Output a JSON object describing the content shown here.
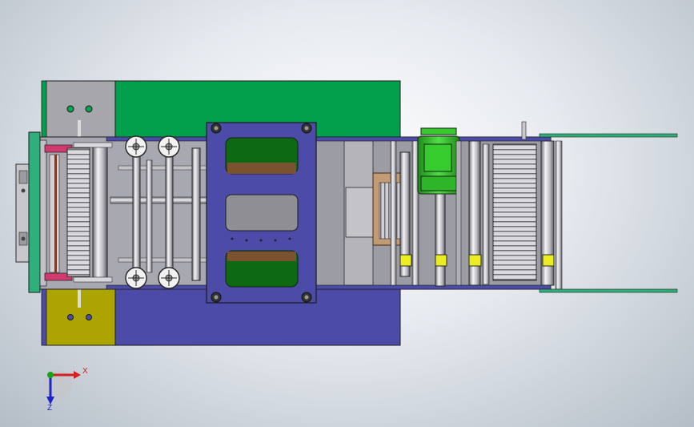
{
  "triad": {
    "x_label": "X",
    "z_label": "Z",
    "x_color": "#d42020",
    "y_color": "#19a319",
    "z_color": "#1c24c9"
  },
  "colors": {
    "frame_green": "#00a04c",
    "frame_blue": "#4c4ca8",
    "plate_olive": "#aca400",
    "motor_green": "#37cc2e",
    "guard_gray": "#a6a6ac",
    "bearing_yellow": "#ecec22",
    "accent_pink": "#d23a6e",
    "copper": "#c29a74"
  }
}
